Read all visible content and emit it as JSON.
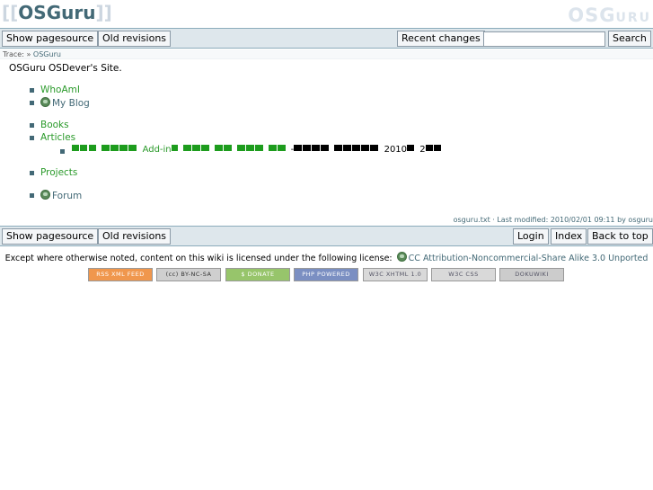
{
  "header": {
    "title_open": "[[",
    "title": "OSGuru",
    "title_close": "]]",
    "logo_big": "OSG",
    "logo_small": "URU"
  },
  "toolbar_top": {
    "show_pagesource": "Show pagesource",
    "old_revisions": "Old revisions",
    "recent_changes": "Recent changes",
    "search_value": "",
    "search_button": "Search"
  },
  "breadcrumbs": {
    "label": "Trace:",
    "sep": "»",
    "item": "OSGuru"
  },
  "content": {
    "intro": "OSGuru OSDever's Site.",
    "items": [
      {
        "label": "WhoAmI",
        "type": "internal"
      },
      {
        "label": "My Blog",
        "type": "external"
      },
      {
        "label": "Books",
        "type": "internal"
      },
      {
        "label": "Articles",
        "type": "internal"
      },
      {
        "label": "Projects",
        "type": "internal"
      },
      {
        "label": "Forum",
        "type": "external"
      }
    ],
    "sub_item": {
      "link_text": "Add-in",
      "dash": "-",
      "year": "2010",
      "num": "2"
    }
  },
  "pageinfo": "osguru.txt · Last modified: 2010/02/01 09:11 by osguru",
  "toolbar_bottom": {
    "show_pagesource": "Show pagesource",
    "old_revisions": "Old revisions",
    "login": "Login",
    "index": "Index",
    "back_to_top": "Back to top"
  },
  "license": {
    "text": "Except where otherwise noted, content on this wiki is licensed under the following license:",
    "link": "CC Attribution-Noncommercial-Share Alike 3.0 Unported"
  },
  "badges": [
    {
      "label": "RSS XML FEED",
      "color": "#f0974d"
    },
    {
      "label": "(cc) BY-NC-SA",
      "color": "#cfcfcf"
    },
    {
      "label": "$ DONATE",
      "color": "#97c56b"
    },
    {
      "label": "PHP POWERED",
      "color": "#7b8fc2"
    },
    {
      "label": "W3C XHTML 1.0",
      "color": "#d9d9d9"
    },
    {
      "label": "W3C CSS",
      "color": "#d9d9d9"
    },
    {
      "label": "DOKUWIKI",
      "color": "#cccccc"
    }
  ],
  "colors": {
    "bar_bg": "#dee7ec",
    "link_internal": "#2a9a2a",
    "link_external": "#436976",
    "title": "#436976"
  }
}
